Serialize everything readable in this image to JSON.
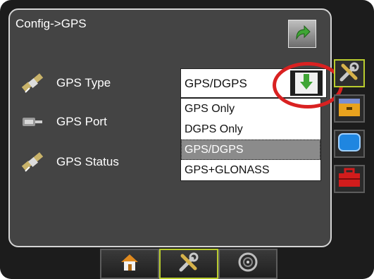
{
  "header": {
    "title": "Config->GPS",
    "back_icon": "back-arrow-icon"
  },
  "settings": [
    {
      "label": "GPS Type",
      "icon": "satellite-icon"
    },
    {
      "label": "GPS Port",
      "icon": "gps-connector-icon"
    },
    {
      "label": "GPS Status",
      "icon": "satellite-icon"
    }
  ],
  "gps_type_select": {
    "value": "GPS/DGPS",
    "options": [
      "GPS Only",
      "DGPS Only",
      "GPS/DGPS",
      "GPS+GLONASS"
    ],
    "selected_index": 2
  },
  "side_tabs": [
    {
      "icon": "tools-icon",
      "active": true
    },
    {
      "icon": "folder-icon",
      "active": false
    },
    {
      "icon": "screen-icon",
      "active": false
    },
    {
      "icon": "toolbox-icon",
      "active": false
    }
  ],
  "bottom_tabs": [
    {
      "icon": "home-icon",
      "active": false
    },
    {
      "icon": "tools-icon",
      "active": true
    },
    {
      "icon": "gauge-icon",
      "active": false
    }
  ],
  "colors": {
    "panel_bg": "#444444",
    "active_border": "#b9cc2e",
    "highlight_ring": "#d92121",
    "arrow_green": "#3fa535"
  }
}
